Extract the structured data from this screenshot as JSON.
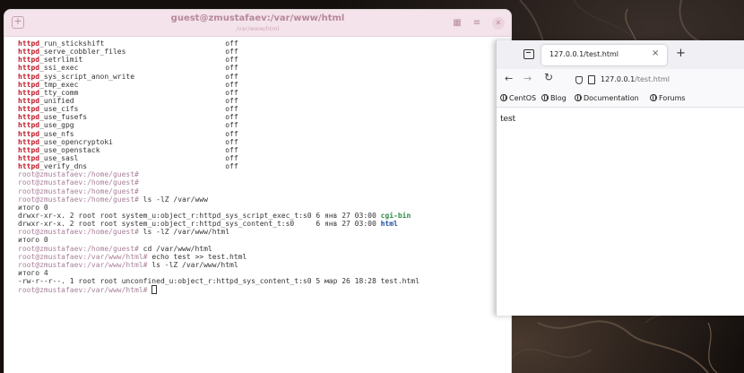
{
  "terminal": {
    "title": "guest@zmustafaev:/var/www/html",
    "subtitle": "/var/www/html",
    "booleans": [
      {
        "prefix": "httpd",
        "suffix": "_run_stickshift",
        "value": "off"
      },
      {
        "prefix": "httpd",
        "suffix": "_serve_cobbler_files",
        "value": "off"
      },
      {
        "prefix": "httpd",
        "suffix": "_setrlimit",
        "value": "off"
      },
      {
        "prefix": "httpd",
        "suffix": "_ssi_exec",
        "value": "off"
      },
      {
        "prefix": "httpd",
        "suffix": "_sys_script_anon_write",
        "value": "off"
      },
      {
        "prefix": "httpd",
        "suffix": "_tmp_exec",
        "value": "off"
      },
      {
        "prefix": "httpd",
        "suffix": "_tty_comm",
        "value": "off"
      },
      {
        "prefix": "httpd",
        "suffix": "_unified",
        "value": "off"
      },
      {
        "prefix": "httpd",
        "suffix": "_use_cifs",
        "value": "off"
      },
      {
        "prefix": "httpd",
        "suffix": "_use_fusefs",
        "value": "off"
      },
      {
        "prefix": "httpd",
        "suffix": "_use_gpg",
        "value": "off"
      },
      {
        "prefix": "httpd",
        "suffix": "_use_nfs",
        "value": "off"
      },
      {
        "prefix": "httpd",
        "suffix": "_use_opencryptoki",
        "value": "off"
      },
      {
        "prefix": "httpd",
        "suffix": "_use_openstack",
        "value": "off"
      },
      {
        "prefix": "httpd",
        "suffix": "_use_sasl",
        "value": "off"
      },
      {
        "prefix": "httpd",
        "suffix": "_verify_dns",
        "value": "off"
      }
    ],
    "lines": [
      {
        "prompt": "root@zmustafaev:/home/guest#",
        "text": ""
      },
      {
        "prompt": "root@zmustafaev:/home/guest#",
        "text": ""
      },
      {
        "prompt": "root@zmustafaev:/home/guest#",
        "text": ""
      },
      {
        "prompt": "root@zmustafaev:/home/guest#",
        "text": " ls -lZ /var/www"
      },
      {
        "prompt": "",
        "text": "итого 0"
      },
      {
        "prompt": "",
        "text": "drwxr-xr-x. 2 root root system_u:object_r:httpd_sys_script_exec_t:s0 6 янв 27 03:00 ",
        "dir": "cgi-bin",
        "dir_class": "dir-exec"
      },
      {
        "prompt": "",
        "text": "drwxr-xr-x. 2 root root system_u:object_r:httpd_sys_content_t:s0     6 янв 27 03:00 ",
        "dir": "html",
        "dir_class": "dir"
      },
      {
        "prompt": "root@zmustafaev:/home/guest#",
        "text": " ls -lZ /var/www/html"
      },
      {
        "prompt": "",
        "text": "итого 0"
      },
      {
        "prompt": "root@zmustafaev:/home/guest#",
        "text": " cd /var/www/html"
      },
      {
        "prompt": "root@zmustafaev:/var/www/html#",
        "text": " echo test >> test.html"
      },
      {
        "prompt": "root@zmustafaev:/var/www/html#",
        "text": " ls -lZ /var/www/html"
      },
      {
        "prompt": "",
        "text": "итого 4"
      },
      {
        "prompt": "",
        "text": "-rw-r--r--. 1 root root unconfined_u:object_r:httpd_sys_content_t:s0 5 мар 26 18:28 test.html"
      },
      {
        "prompt": "root@zmustafaev:/var/www/html#",
        "text": " ",
        "cursor": true
      }
    ]
  },
  "browser": {
    "tab_title": "127.0.0.1/test.html",
    "tab_close": "×",
    "new_tab": "+",
    "url_host": "127.0.0.1",
    "url_path": "/test.html",
    "bookmarks": [
      "CentOS",
      "Blog",
      "Documentation",
      "Forums"
    ],
    "page_text": "test"
  }
}
